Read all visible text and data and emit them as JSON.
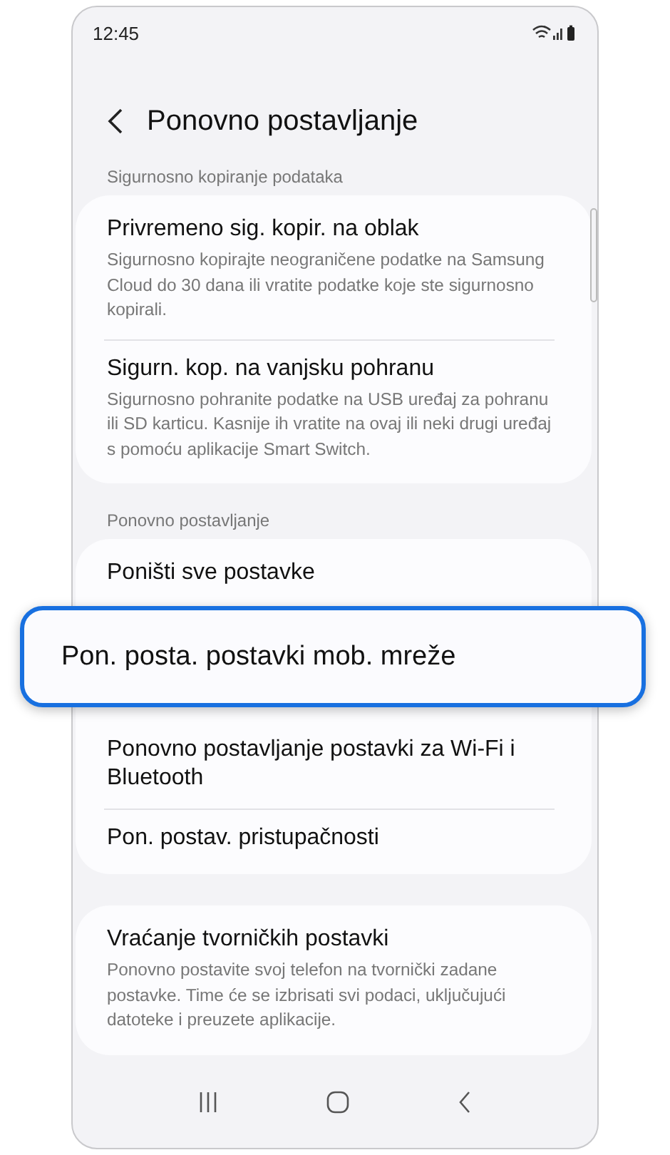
{
  "status_bar": {
    "time": "12:45"
  },
  "header": {
    "title": "Ponovno postavljanje"
  },
  "sections": [
    {
      "label": "Sigurnosno kopiranje podataka",
      "items": [
        {
          "title": "Privremeno sig. kopir. na oblak",
          "subtitle": "Sigurnosno kopirajte neograničene podatke na Samsung Cloud do 30 dana ili vratite podatke koje ste sigurnosno kopirali.",
          "highlighted": false
        },
        {
          "title": "Sigurn. kop. na vanjsku pohranu",
          "subtitle": "Sigurnosno pohranite podatke na USB uređaj za pohranu ili SD karticu. Kasnije ih vratite na ovaj ili neki drugi uređaj s pomoću aplikacije Smart Switch.",
          "highlighted": false
        }
      ]
    },
    {
      "label": "Ponovno postavljanje",
      "items": [
        {
          "title": "Poništi sve postavke",
          "highlighted": false
        },
        {
          "title": "Pon. posta. postavki mob. mreže",
          "highlighted": true
        },
        {
          "title": "Ponovno postavljanje postavki za Wi-Fi i Bluetooth",
          "highlighted": false
        },
        {
          "title": "Pon. postav. pristupačnosti",
          "highlighted": false
        }
      ]
    },
    {
      "items": [
        {
          "title": "Vraćanje tvorničkih postavki",
          "subtitle": "Ponovno postavite svoj telefon na tvornički zadane postavke. Time će se izbrisati svi podaci, uključujući datoteke i preuzete aplikacije.",
          "highlighted": false
        }
      ]
    }
  ]
}
